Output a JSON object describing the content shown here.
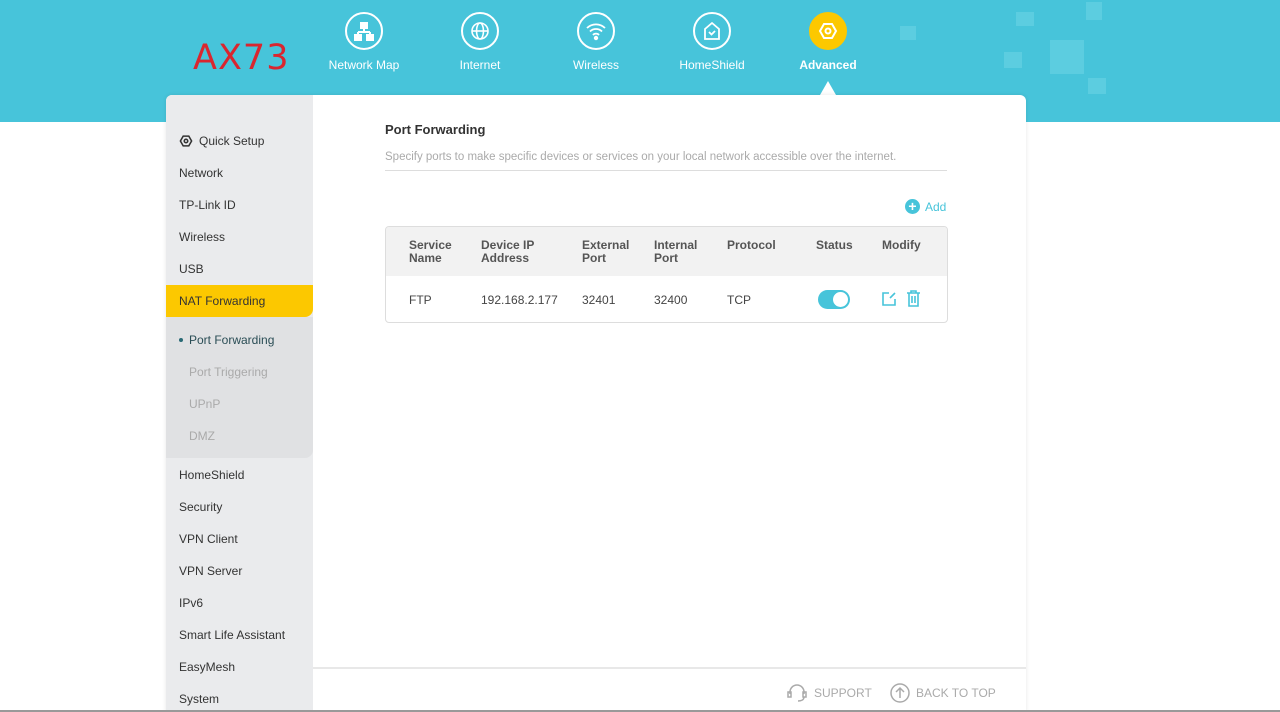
{
  "brand": {
    "logo": "AX73"
  },
  "topnav": [
    {
      "label": "Network Map",
      "icon": "network-map-icon"
    },
    {
      "label": "Internet",
      "icon": "globe-icon"
    },
    {
      "label": "Wireless",
      "icon": "wifi-icon"
    },
    {
      "label": "HomeShield",
      "icon": "homeshield-icon"
    },
    {
      "label": "Advanced",
      "icon": "gear-icon",
      "active": true
    }
  ],
  "sidebar": {
    "items": [
      "Quick Setup",
      "Network",
      "TP-Link ID",
      "Wireless",
      "USB",
      "NAT Forwarding",
      "HomeShield",
      "Security",
      "VPN Client",
      "VPN Server",
      "IPv6",
      "Smart Life Assistant",
      "EasyMesh",
      "System"
    ],
    "sub": [
      "Port Forwarding",
      "Port Triggering",
      "UPnP",
      "DMZ"
    ]
  },
  "page": {
    "title": "Port Forwarding",
    "description": "Specify ports to make specific devices or services on your local network accessible over the internet.",
    "add_label": "Add"
  },
  "table": {
    "headers": [
      [
        "Service",
        "Name"
      ],
      [
        "Device IP",
        "Address"
      ],
      [
        "External",
        "Port"
      ],
      [
        "Internal",
        "Port"
      ],
      [
        "Protocol",
        ""
      ],
      [
        "Status",
        ""
      ],
      [
        "Modify",
        ""
      ]
    ],
    "rows": [
      {
        "service": "FTP",
        "ip": "192.168.2.177",
        "external": "32401",
        "internal": "32400",
        "protocol": "TCP",
        "enabled": true
      }
    ]
  },
  "footer": {
    "support": "SUPPORT",
    "back_to_top": "BACK TO TOP"
  },
  "colors": {
    "accent": "#47c4da",
    "highlight": "#fcc800"
  }
}
